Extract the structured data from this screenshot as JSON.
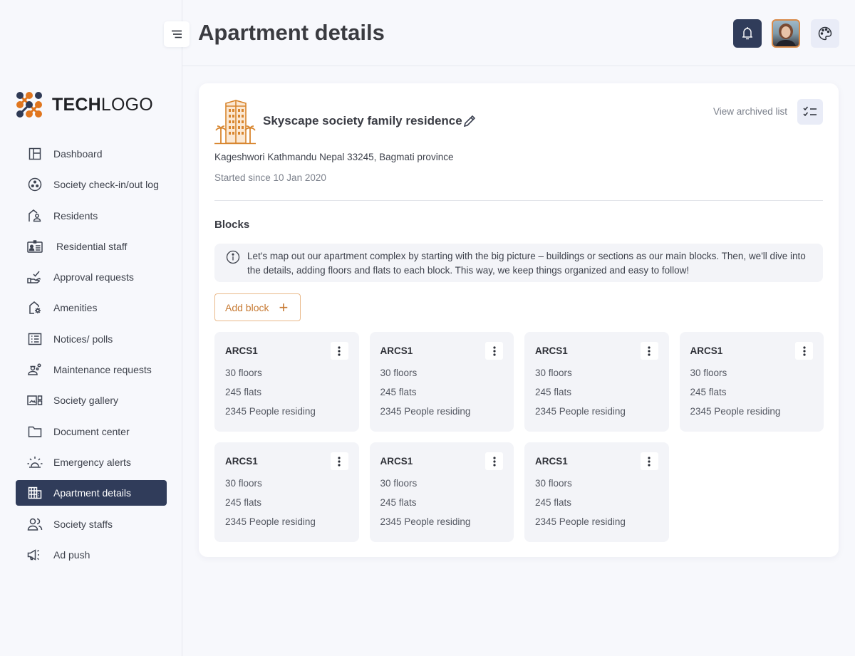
{
  "app": {
    "logo_bold": "TECH",
    "logo_light": "LOGO",
    "page_title": "Apartment details"
  },
  "colors": {
    "primary_navy": "#303c5a",
    "accent_orange": "#d8862f",
    "background": "#f7f8fc",
    "card_tile": "#f3f4f8"
  },
  "sidebar": {
    "items": [
      {
        "label": "Dashboard",
        "icon": "dashboard-icon",
        "active": false
      },
      {
        "label": "Society check-in/out log",
        "icon": "checkin-log-icon",
        "active": false
      },
      {
        "label": "Residents",
        "icon": "residents-icon",
        "active": false
      },
      {
        "label": "Residential staff",
        "icon": "id-card-icon",
        "active": false
      },
      {
        "label": "Approval requests",
        "icon": "approval-hand-icon",
        "active": false
      },
      {
        "label": "Amenities",
        "icon": "amenities-icon",
        "active": false
      },
      {
        "label": "Notices/ polls",
        "icon": "notices-icon",
        "active": false
      },
      {
        "label": "Maintenance requests",
        "icon": "maintenance-icon",
        "active": false
      },
      {
        "label": "Society gallery",
        "icon": "gallery-icon",
        "active": false
      },
      {
        "label": "Document center",
        "icon": "folder-icon",
        "active": false
      },
      {
        "label": "Emergency alerts",
        "icon": "siren-icon",
        "active": false
      },
      {
        "label": "Apartment details",
        "icon": "building-icon",
        "active": true
      },
      {
        "label": "Society staffs",
        "icon": "staff-icon",
        "active": false
      },
      {
        "label": "Ad push",
        "icon": "megaphone-icon",
        "active": false
      }
    ]
  },
  "header": {
    "icons": [
      "menu-icon",
      "bell-icon",
      "avatar",
      "palette-icon"
    ]
  },
  "residence": {
    "name": "Skyscape society family residence",
    "address": "Kageshwori Kathmandu Nepal 33245, Bagmati province",
    "since": "Started since 10 Jan 2020",
    "view_archived": "View archived list"
  },
  "blocks": {
    "title": "Blocks",
    "info": "Let's map out our apartment complex by starting with the big picture – buildings or sections as our main blocks. Then, we'll dive into the details, adding floors and flats to each block. This way, we keep things organized and easy to follow!",
    "add_label": "Add block",
    "add_icon": "+",
    "items": [
      {
        "name": "ARCS1",
        "floors": "30 floors",
        "flats": "245 flats",
        "people": "2345 People residing"
      },
      {
        "name": "ARCS1",
        "floors": "30 floors",
        "flats": "245 flats",
        "people": "2345 People residing"
      },
      {
        "name": "ARCS1",
        "floors": "30 floors",
        "flats": "245 flats",
        "people": "2345 People residing"
      },
      {
        "name": "ARCS1",
        "floors": "30 floors",
        "flats": "245 flats",
        "people": "2345 People residing"
      },
      {
        "name": "ARCS1",
        "floors": "30 floors",
        "flats": "245 flats",
        "people": "2345 People residing"
      },
      {
        "name": "ARCS1",
        "floors": "30 floors",
        "flats": "245 flats",
        "people": "2345 People residing"
      },
      {
        "name": "ARCS1",
        "floors": "30 floors",
        "flats": "245 flats",
        "people": "2345 People residing"
      }
    ]
  }
}
